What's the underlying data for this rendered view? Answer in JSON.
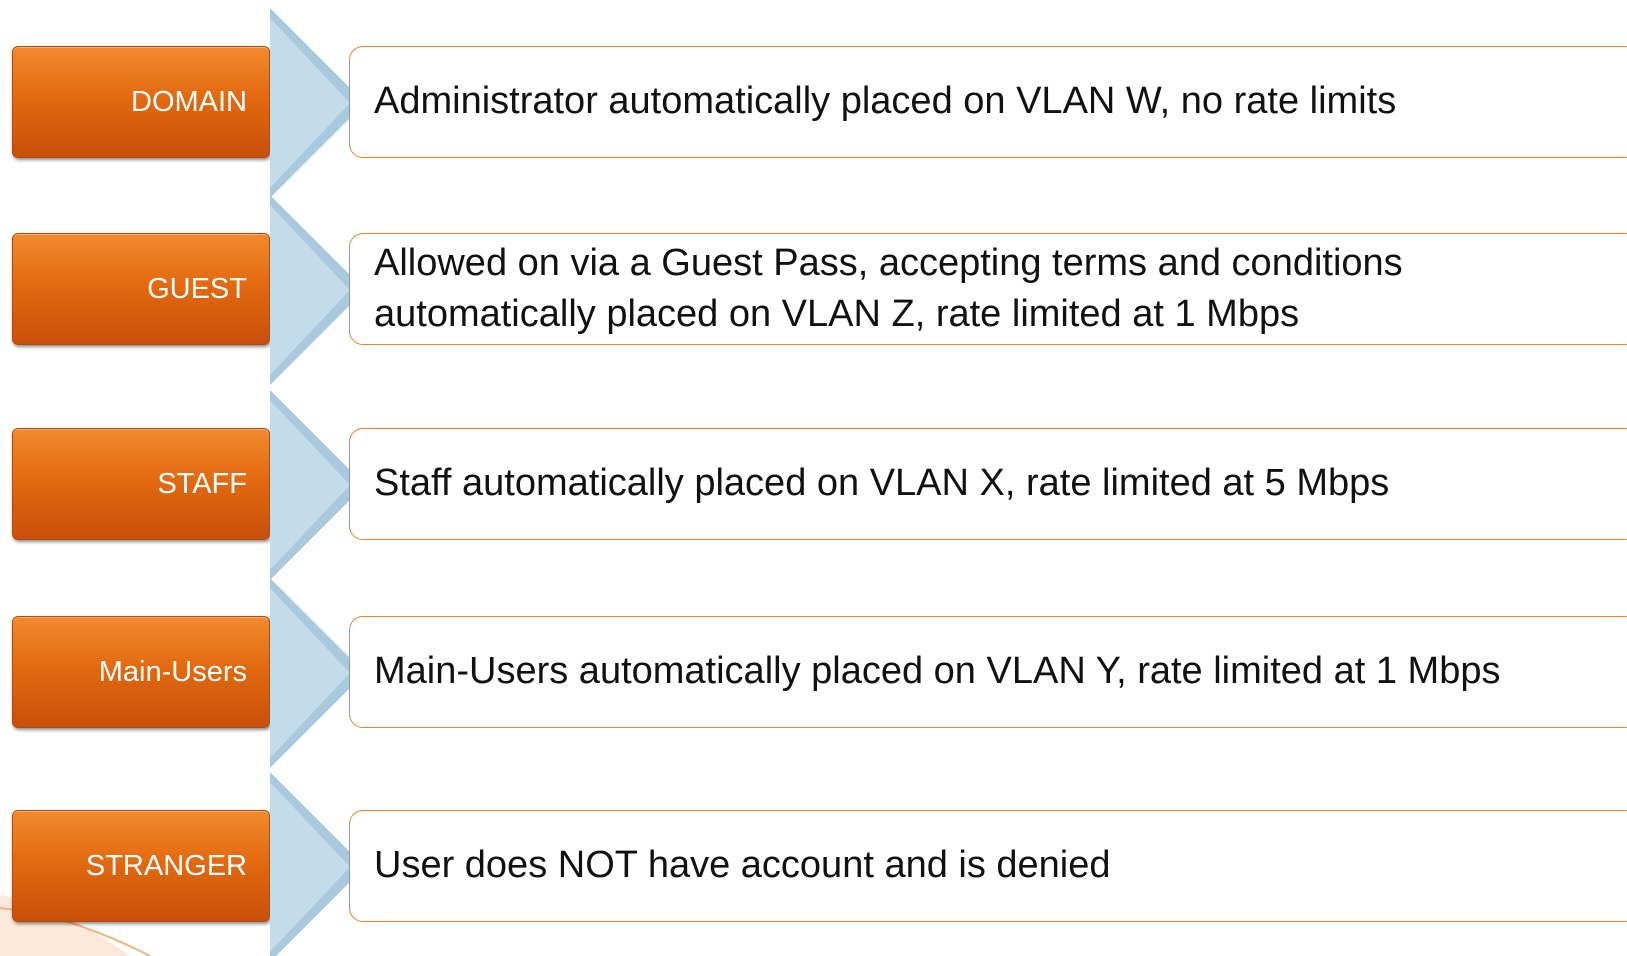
{
  "colors": {
    "category_fill": "#e36a10",
    "category_text": "#ffffff",
    "description_border": "#e8832c",
    "arrow_fill": "#a9c9df",
    "description_text": "#111111"
  },
  "rows": [
    {
      "category": "DOMAIN",
      "description": "Administrator automatically placed on VLAN W, no rate limits"
    },
    {
      "category": "GUEST",
      "description": "Allowed on via a Guest Pass, accepting terms and conditions automatically placed on VLAN Z, rate limited at 1 Mbps"
    },
    {
      "category": "STAFF",
      "description": "Staff automatically placed on VLAN X, rate limited at 5 Mbps"
    },
    {
      "category": "Main-Users",
      "description": "Main-Users automatically placed on VLAN Y, rate limited at 1 Mbps"
    },
    {
      "category": "STRANGER",
      "description": "User does NOT have account and is denied"
    }
  ]
}
